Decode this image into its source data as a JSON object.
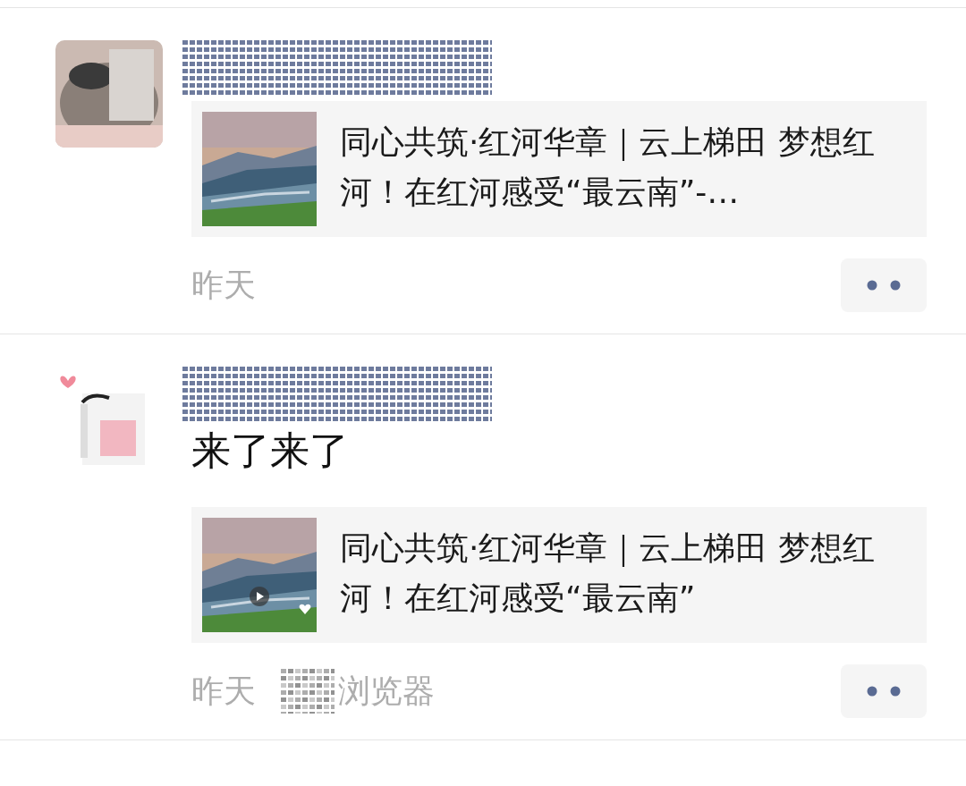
{
  "posts": [
    {
      "link": {
        "title": "同心共筑·红河华章｜云上梯田 梦想红河！在红河感受“最云南”-…",
        "video": false
      },
      "time": "昨天"
    },
    {
      "content": "来了来了",
      "link": {
        "title": "同心共筑·红河华章｜云上梯田 梦想红河！在红河感受“最云南”",
        "video": true
      },
      "time": "昨天",
      "source": "浏览器"
    }
  ]
}
